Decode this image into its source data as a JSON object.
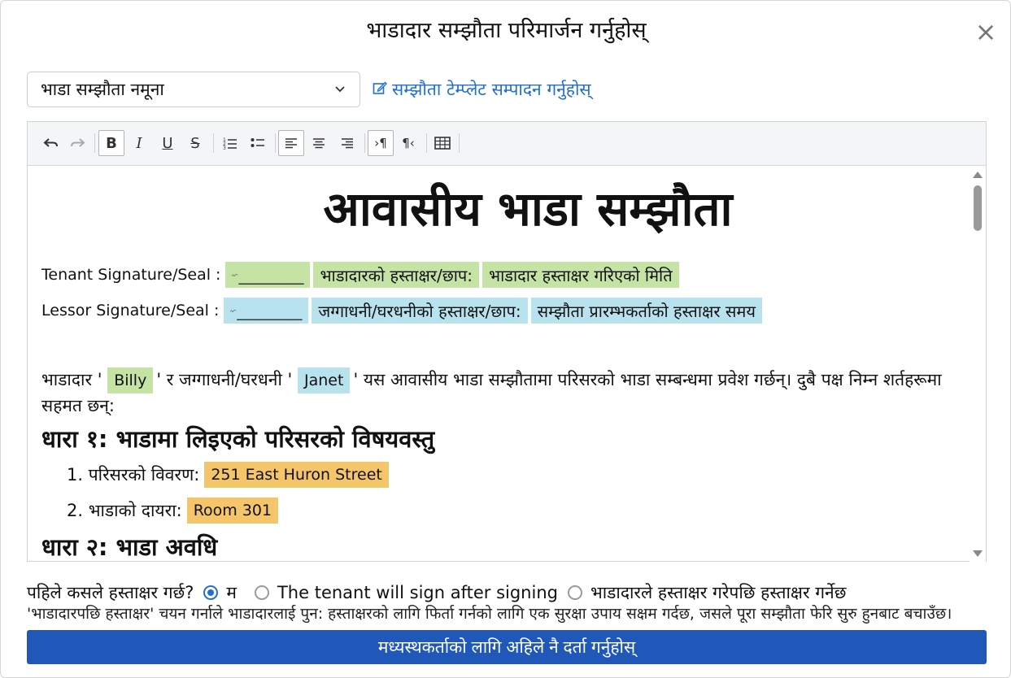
{
  "dialog": {
    "title": "भाडादार सम्झौता परिमार्जन गर्नुहोस्",
    "close_symbol": "×"
  },
  "template_select": {
    "value": "भाडा सम्झौता नमूना",
    "edit_link": "सम्झौता टेम्प्लेट सम्पादन गर्नुहोस्"
  },
  "toolbar": {
    "buttons": [
      "undo-icon",
      "redo-icon",
      "bold-icon",
      "italic-icon",
      "underline-icon",
      "strikethrough-icon",
      "ordered-list-icon",
      "bullet-list-icon",
      "align-left-icon",
      "align-center-icon",
      "align-right-icon",
      "ltr-icon",
      "rtl-icon",
      "table-icon"
    ]
  },
  "document": {
    "title": "आवासीय भाडा सम्झौता",
    "tenant_sig_label": "Tenant Signature/Seal :",
    "tenant_sig_field": "भाडादारको हस्ताक्षर/छाप:",
    "tenant_date_field": "भाडादार हस्ताक्षर गरिएको मिति",
    "lessor_sig_label": "Lessor Signature/Seal :",
    "lessor_sig_field": "जग्गाधनी/घरधनीको हस्ताक्षर/छाप:",
    "lessor_time_field": "सम्झौता प्रारम्भकर्ताको हस्ताक्षर समय",
    "signature_placeholder": "________",
    "intro_prefix": "भाडादार '",
    "tenant_name": "Billy",
    "intro_mid": "' र जग्गाधनी/घरधनी '",
    "lessor_name": "Janet",
    "intro_suffix": "' यस आवासीय भाडा सम्झौतामा परिसरको भाडा सम्बन्धमा प्रवेश गर्छन्। दुबै पक्ष निम्न शर्तहरूमा सहमत छन्:",
    "section1_heading": "धारा १: भाडामा लिइएको परिसरको विषयवस्तु",
    "item1_label": "1. परिसरको विवरण:",
    "item1_value": "251 East Huron Street",
    "item2_label": "2. भाडाको दायरा:",
    "item2_value": "Room 301",
    "section2_heading": "धारा २: भाडा अवधि"
  },
  "sign_order": {
    "question": "पहिले कसले हस्ताक्षर गर्छ?",
    "option_me": "म",
    "option_tenant_after": "The tenant will sign after signing",
    "option_after_tenant": "भाडादारले हस्ताक्षर गरेपछि हस्ताक्षर गर्नेछ",
    "note": "'भाडादारपछि हस्ताक्षर' चयन गर्नाले भाडादारलाई पुन: हस्ताक्षरको लागि फिर्ता गर्नको लागि एक सुरक्षा उपाय सक्षम गर्दछ, जसले पूरा सम्झौता फेरि सुरु हुनबाट बचाउँछ।"
  },
  "submit": {
    "label": "मध्यस्थकर्ताको लागि अहिले नै दर्ता गर्नुहोस्"
  },
  "colors": {
    "accent": "#1f58b8",
    "link": "#1f6fd1",
    "tenant_highlight": "#c6e3a6",
    "lessor_highlight": "#b9e2ef",
    "property_highlight": "#f5c56b"
  }
}
